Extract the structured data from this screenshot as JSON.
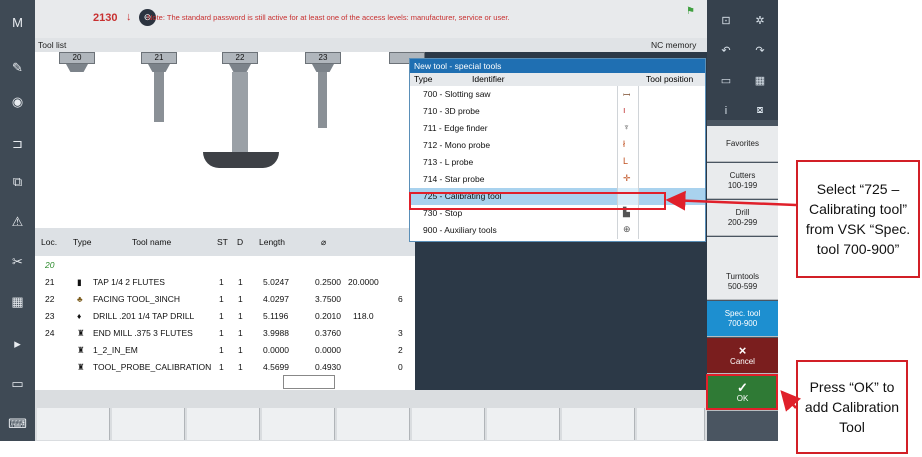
{
  "topbar": {
    "alarm_number": "2130",
    "alarm_arrow": "↓",
    "alarm_message": "Note: The standard password is still active for at least one of the access levels: manufacturer, service or user."
  },
  "list_header": {
    "title": "Tool list",
    "memory": "NC memory"
  },
  "holders": [
    "20",
    "21",
    "22",
    "23"
  ],
  "table": {
    "columns": [
      "Loc.",
      "Type",
      "Tool name",
      "ST",
      "D",
      "Length",
      "⌀"
    ],
    "rows": [
      {
        "loc": "20",
        "type_icon": "empty",
        "name": "",
        "st": "",
        "d": "",
        "length": "",
        "dia": "",
        "extra": "",
        "extra2": ""
      },
      {
        "loc": "21",
        "type_icon": "tap-icon",
        "name": "TAP 1/4 2 FLUTES",
        "st": "1",
        "d": "1",
        "length": "5.0247",
        "dia": "0.2500",
        "extra": "20.0000",
        "extra2": ""
      },
      {
        "loc": "22",
        "type_icon": "facing-icon",
        "name": "FACING TOOL_3INCH",
        "st": "1",
        "d": "1",
        "length": "4.0297",
        "dia": "3.7500",
        "extra": "",
        "extra2": "6"
      },
      {
        "loc": "23",
        "type_icon": "drill-icon",
        "name": "DRILL .201 1/4 TAP DRILL",
        "st": "1",
        "d": "1",
        "length": "5.1196",
        "dia": "0.2010",
        "extra": "118.0",
        "extra2": ""
      },
      {
        "loc": "24",
        "type_icon": "endmill-icon",
        "name": "END MILL .375 3 FLUTES",
        "st": "1",
        "d": "1",
        "length": "3.9988",
        "dia": "0.3760",
        "extra": "",
        "extra2": "3"
      },
      {
        "loc": "",
        "type_icon": "endmill-icon",
        "name": "1_2_IN_EM",
        "st": "1",
        "d": "1",
        "length": "0.0000",
        "dia": "0.0000",
        "extra": "",
        "extra2": "2"
      },
      {
        "loc": "",
        "type_icon": "endmill-icon",
        "name": "TOOL_PROBE_CALIBRATION",
        "st": "1",
        "d": "1",
        "length": "4.5699",
        "dia": "0.4930",
        "extra": "",
        "extra2": "0"
      }
    ]
  },
  "dialog": {
    "title": "New tool - special tools",
    "col_type": "Type",
    "col_identifier": "Identifier",
    "col_position": "Tool position",
    "items": [
      {
        "label": "700 -  Slotting saw",
        "icon": "saw-icon"
      },
      {
        "label": "710 -  3D probe",
        "icon": "probe-icon"
      },
      {
        "label": "711 -  Edge finder",
        "icon": "edge-finder-icon"
      },
      {
        "label": "712 -  Mono probe",
        "icon": "mono-probe-icon"
      },
      {
        "label": "713 -  L probe",
        "icon": "l-probe-icon"
      },
      {
        "label": "714 -  Star probe",
        "icon": "star-probe-icon"
      },
      {
        "label": "725 -  Calibrating tool",
        "icon": "calibrating-tool-icon",
        "selected": true
      },
      {
        "label": "730 -  Stop",
        "icon": "stop-icon"
      },
      {
        "label": "900 -  Auxiliary tools",
        "icon": "auxiliary-icon"
      }
    ]
  },
  "vsk": {
    "favorites": "Favorites",
    "cutters": [
      "Cutters",
      "100-199"
    ],
    "drill": [
      "Drill",
      "200-299"
    ],
    "turntools": [
      "Turntools",
      "500-599"
    ],
    "spec_tool": [
      "Spec. tool",
      "700-900"
    ],
    "cancel": "Cancel",
    "ok": "OK",
    "cancel_symbol": "×",
    "ok_symbol": "✓"
  },
  "callouts": {
    "select": "Select “725 – Calibrating tool” from VSK “Spec. tool 700-900”",
    "press_ok": "Press “OK” to add Calibration Tool"
  },
  "colors": {
    "accent": "#1f6fb2",
    "highlight": "#e0202a",
    "alarm": "#c83030"
  }
}
